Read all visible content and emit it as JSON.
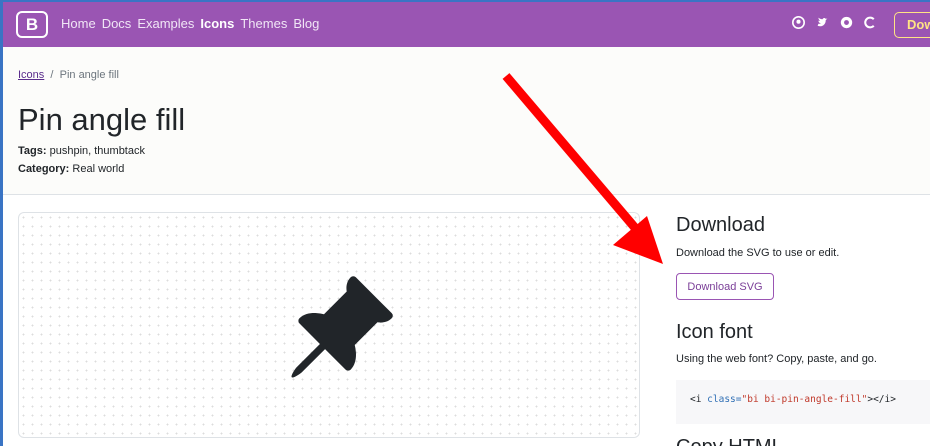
{
  "navbar": {
    "brand": "B",
    "links": [
      "Home",
      "Docs",
      "Examples",
      "Icons",
      "Themes",
      "Blog"
    ],
    "active": "Icons",
    "icons": [
      "github-icon",
      "twitter-icon",
      "opencollective-icon",
      "slack-icon"
    ],
    "download_label": "Down"
  },
  "breadcrumb": {
    "parent": "Icons",
    "separator": "/",
    "current": "Pin angle fill"
  },
  "page": {
    "title": "Pin angle fill",
    "tags_label": "Tags:",
    "tags_value": "pushpin, thumbtack",
    "category_label": "Category:",
    "category_value": "Real world"
  },
  "preview": {
    "icon": "pin-angle-fill-icon"
  },
  "download_section": {
    "heading": "Download",
    "text": "Download the SVG to use or edit.",
    "button": "Download SVG"
  },
  "font_section": {
    "heading": "Icon font",
    "text": "Using the web font? Copy, paste, and go.",
    "code_open": "<i ",
    "code_attr": "class=",
    "code_value": "\"bi bi-pin-angle-fill\"",
    "code_close": "></i>"
  },
  "next_heading": "Copy HTML",
  "colors": {
    "navbar": "#9a55b3",
    "arrow": "#ff0000",
    "accent": "#7b3f98"
  }
}
